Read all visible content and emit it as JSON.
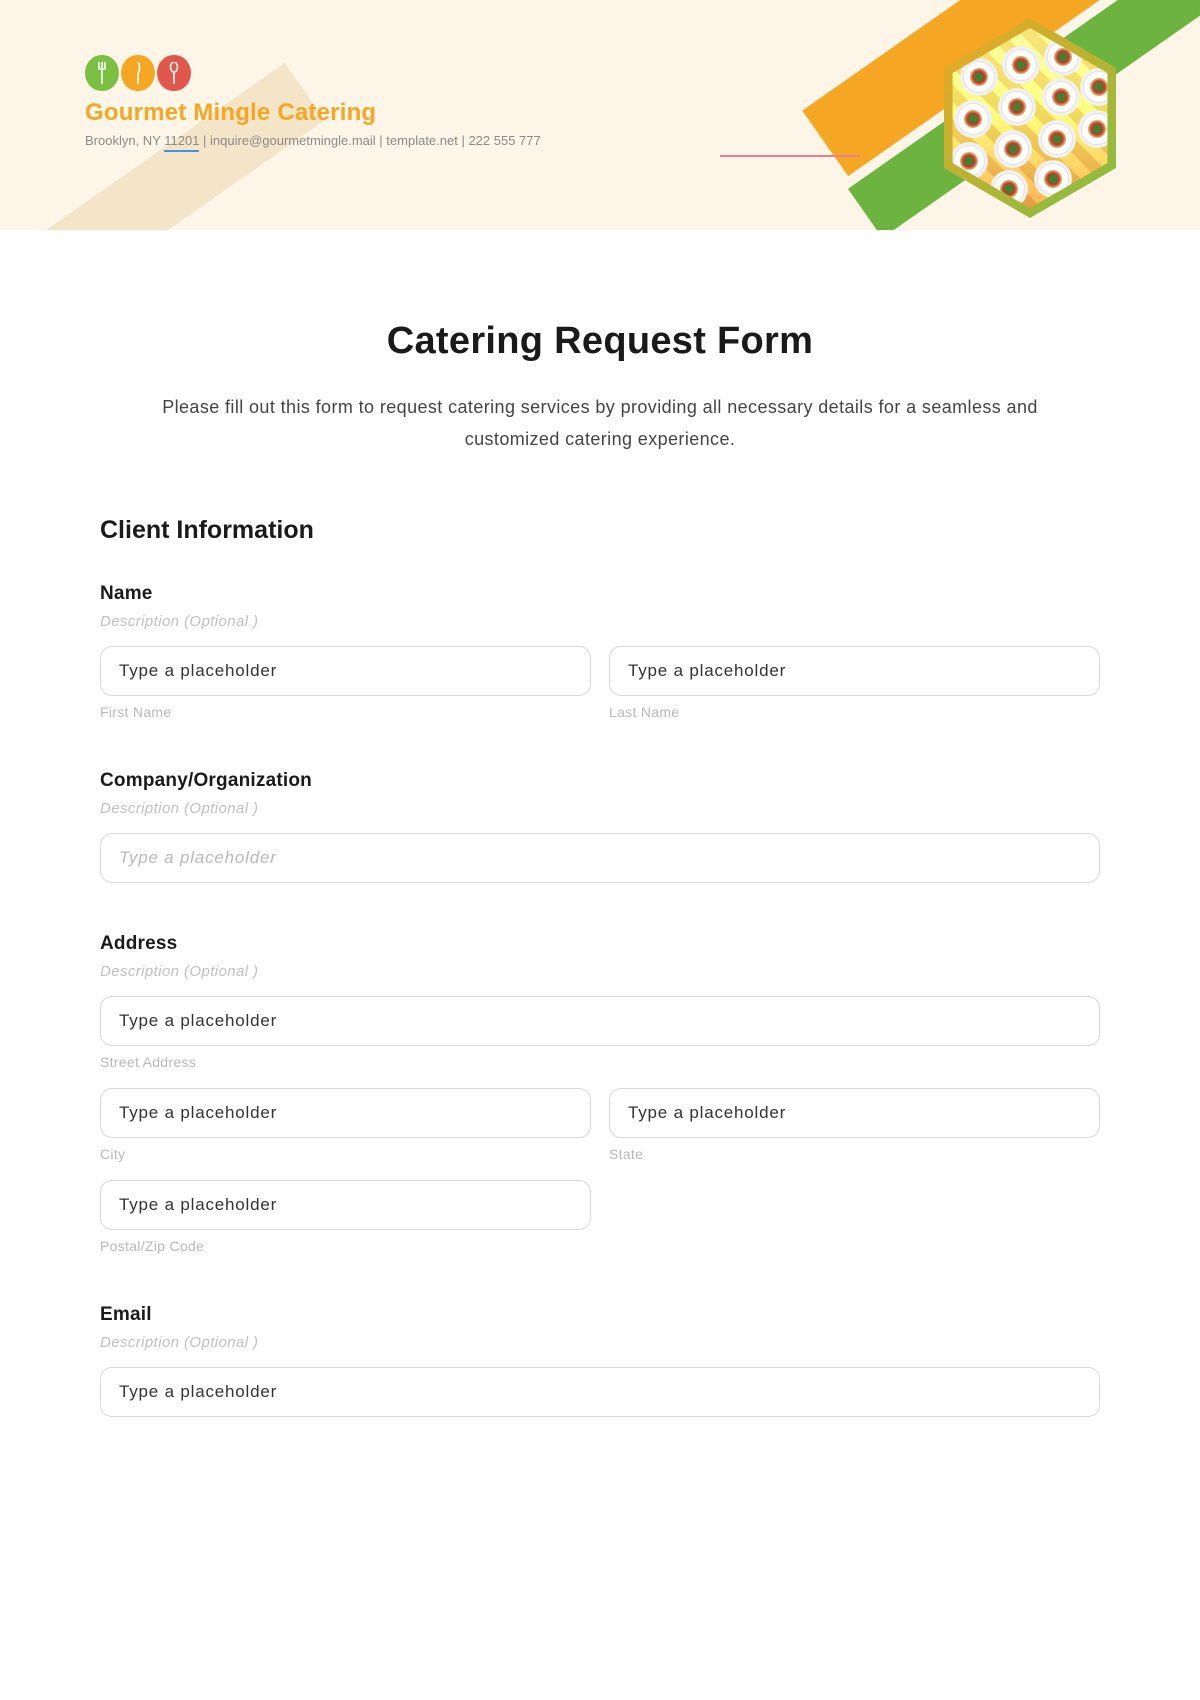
{
  "header": {
    "brand_name": "Gourmet Mingle Catering",
    "contact_line_prefix": "Brooklyn, NY ",
    "contact_zip": "11201",
    "contact_line_suffix": " | inquire@gourmetmingle.mail | template.net | 222 555 777",
    "logo_icons": [
      "fork-icon",
      "knife-icon",
      "spoon-icon"
    ],
    "colors": {
      "green": "#7bc043",
      "orange": "#f5a623",
      "red": "#e2574c"
    }
  },
  "page": {
    "title": "Catering Request Form",
    "intro": "Please fill out this form to request catering services by providing all necessary details for a seamless and customized catering experience."
  },
  "section_client": {
    "heading": "Client Information",
    "name": {
      "label": "Name",
      "desc": "Description (Optional )",
      "first_value": "Type a placeholder",
      "first_sub": "First Name",
      "last_value": "Type a placeholder",
      "last_sub": "Last Name"
    },
    "company": {
      "label": "Company/Organization",
      "desc": "Description (Optional )",
      "placeholder": "Type a placeholder"
    },
    "address": {
      "label": "Address",
      "desc": "Description (Optional )",
      "street_value": "Type a placeholder",
      "street_sub": "Street Address",
      "city_value": "Type a placeholder",
      "city_sub": "City",
      "state_value": "Type a placeholder",
      "state_sub": "State",
      "postal_value": "Type a placeholder",
      "postal_sub": "Postal/Zip Code"
    },
    "email": {
      "label": "Email",
      "desc": "Description (Optional )",
      "value": "Type a placeholder"
    }
  }
}
